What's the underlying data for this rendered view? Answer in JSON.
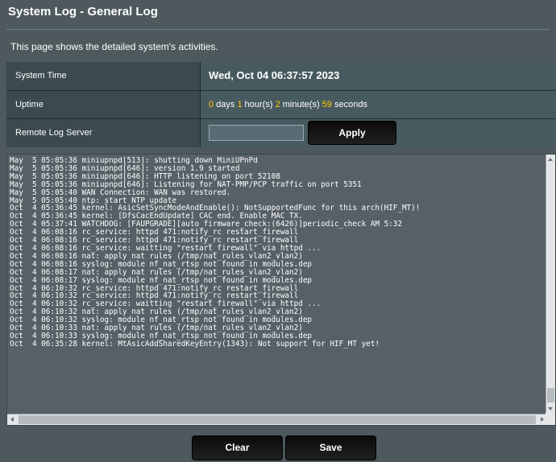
{
  "page": {
    "title": "System Log - General Log",
    "description": "This page shows the detailed system's activities."
  },
  "info": {
    "system_time_label": "System Time",
    "system_time_value": "Wed, Oct 04 06:37:57 2023",
    "uptime_label": "Uptime",
    "uptime": {
      "days": "0",
      "days_unit": " days ",
      "hours": "1",
      "hours_unit": " hour(s) ",
      "minutes": "2",
      "minutes_unit": " minute(s) ",
      "seconds": "59",
      "seconds_unit": " seconds"
    },
    "remote_log_label": "Remote Log Server",
    "remote_log_value": "",
    "apply_label": "Apply"
  },
  "log": {
    "lines": [
      "May  5 05:05:36 miniupnpd[513]: shutting down MiniUPnPd",
      "May  5 05:05:36 miniupnpd[646]: version 1.9 started",
      "May  5 05:05:36 miniupnpd[646]: HTTP listening on port 52108",
      "May  5 05:05:36 miniupnpd[646]: Listening for NAT-PMP/PCP traffic on port 5351",
      "May  5 05:05:40 WAN Connection: WAN was restored.",
      "May  5 05:05:40 ntp: start NTP update",
      "Oct  4 05:36:45 kernel: AsicSetSyncModeAndEnable(): NotSupportedFunc for this arch(HIF_MT)!",
      "Oct  4 05:36:45 kernel: [DfsCacEndUpdate] CAC end. Enable MAC TX.",
      "Oct  4 05:37:41 WATCHDOG: [FAUPGRADE][auto_firmware_check:(6426)]periodic_check AM 5:32",
      "Oct  4 06:08:16 rc_service: httpd 471:notify_rc restart_firewall",
      "Oct  4 06:08:16 rc_service: httpd 471:notify_rc restart_firewall",
      "Oct  4 06:08:16 rc_service: waitting \"restart_firewall\" via httpd ...",
      "Oct  4 06:08:16 nat: apply nat rules (/tmp/nat_rules_vlan2_vlan2)",
      "Oct  4 06:08:16 syslog: module nf_nat_rtsp not found in modules.dep",
      "Oct  4 06:08:17 nat: apply nat rules (/tmp/nat_rules_vlan2_vlan2)",
      "Oct  4 06:08:17 syslog: module nf_nat_rtsp not found in modules.dep",
      "Oct  4 06:10:32 rc_service: httpd 471:notify_rc restart_firewall",
      "Oct  4 06:10:32 rc_service: httpd 471:notify_rc restart_firewall",
      "Oct  4 06:10:32 rc_service: waitting \"restart_firewall\" via httpd ...",
      "Oct  4 06:10:32 nat: apply nat rules (/tmp/nat_rules_vlan2_vlan2)",
      "Oct  4 06:10:32 syslog: module nf_nat_rtsp not found in modules.dep",
      "Oct  4 06:10:33 nat: apply nat rules (/tmp/nat_rules_vlan2_vlan2)",
      "Oct  4 06:10:33 syslog: module nf_nat_rtsp not found in modules.dep",
      "Oct  4 06:35:28 kernel: MtAsicAddSharedKeyEntry(1343): Not support for HIF_MT yet!"
    ]
  },
  "actions": {
    "clear_label": "Clear",
    "save_label": "Save"
  },
  "colors": {
    "background": "#4d595d",
    "label_cell": "#3b4a4f",
    "value_cell": "#475a5f",
    "uptime_number": "#ffcc00",
    "button": "#111111"
  }
}
